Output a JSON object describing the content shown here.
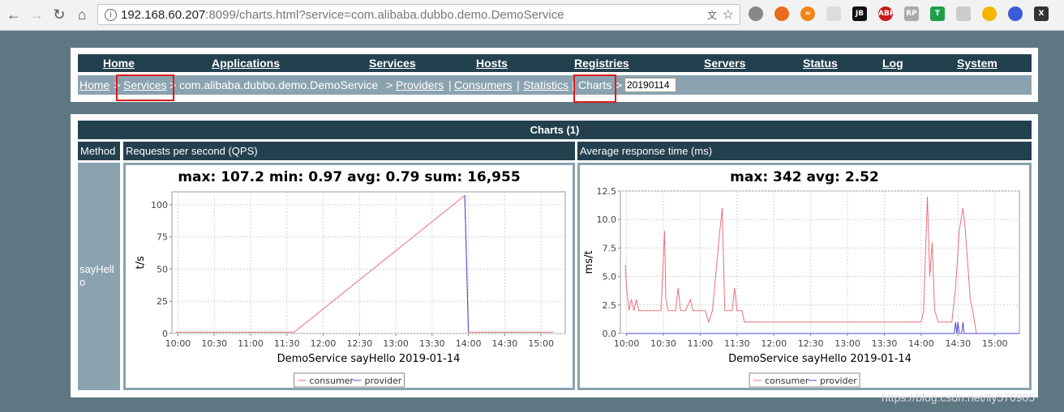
{
  "browser": {
    "url_host": "192.168.60.207",
    "url_rest": ":8099/charts.html?service=com.alibaba.dubbo.demo.DemoService"
  },
  "menu": [
    "Home",
    "Applications",
    "Services",
    "Hosts",
    "Registries",
    "Servers",
    "Status",
    "Log",
    "System"
  ],
  "breadcrumb": {
    "home": "Home",
    "sep1": ">",
    "services": "Services",
    "sep2": ">",
    "service_name": "com.alibaba.dubbo.demo.DemoService",
    "sep3": ">",
    "providers": "Providers",
    "bar1": "|",
    "consumers": "Consumers",
    "bar2": "|",
    "statistics": "Statistics",
    "bar3": "|",
    "charts": "Charts",
    "sep4": ">",
    "date": "20190114"
  },
  "charts_table": {
    "header": "Charts (1)",
    "col_method": "Method",
    "col_qps": "Requests per second (QPS)",
    "col_rt": "Average response time (ms)",
    "method": "sayHello"
  },
  "watermark": "https://blog.csdn.net/lly576905",
  "chart_data": [
    {
      "type": "line",
      "title": "max: 107.2 min: 0.97 avg: 0.79 sum: 16,955",
      "xlabel": "DemoService  sayHello  2019-01-14",
      "ylabel": "t/s",
      "ylim": [
        0,
        110
      ],
      "yticks": [
        "0",
        "25",
        "50",
        "75",
        "100"
      ],
      "xticks": [
        "10:00",
        "10:30",
        "11:00",
        "11:30",
        "12:00",
        "12:30",
        "13:00",
        "13:30",
        "14:00",
        "14:30",
        "15:00"
      ],
      "legend": [
        "consumer",
        "provider"
      ],
      "series": [
        {
          "name": "consumer",
          "color": "#e8707a",
          "points": [
            [
              "09:58",
              1
            ],
            [
              "10:30",
              1
            ],
            [
              "11:00",
              1
            ],
            [
              "11:30",
              1
            ],
            [
              "11:36",
              1
            ],
            [
              "13:57",
              107.2
            ],
            [
              "14:00",
              1
            ],
            [
              "14:30",
              1
            ],
            [
              "15:00",
              1
            ],
            [
              "15:10",
              1
            ]
          ]
        },
        {
          "name": "provider",
          "color": "#4a4ad6",
          "points": [
            [
              "13:57",
              107.2
            ],
            [
              "14:00",
              1
            ]
          ]
        }
      ]
    },
    {
      "type": "line",
      "title": "max: 342 avg: 2.52",
      "xlabel": "DemoService  sayHello  2019-01-14",
      "ylabel": "ms/t",
      "ylim": [
        0,
        12.5
      ],
      "yticks": [
        "0.0",
        "2.5",
        "5.0",
        "7.5",
        "10.0",
        "12.5"
      ],
      "xticks": [
        "10:00",
        "10:30",
        "11:00",
        "11:30",
        "12:00",
        "12:30",
        "13:00",
        "13:30",
        "14:00",
        "14:30",
        "15:00"
      ],
      "legend": [
        "consumer",
        "provider"
      ],
      "series": [
        {
          "name": "consumer",
          "color": "#e8707a",
          "points": [
            [
              "09:59",
              6
            ],
            [
              "10:00",
              4
            ],
            [
              "10:02",
              2
            ],
            [
              "10:04",
              3
            ],
            [
              "10:06",
              2
            ],
            [
              "10:08",
              3
            ],
            [
              "10:10",
              2
            ],
            [
              "10:20",
              2
            ],
            [
              "10:28",
              2
            ],
            [
              "10:31",
              9
            ],
            [
              "10:32",
              3
            ],
            [
              "10:34",
              2
            ],
            [
              "10:40",
              2
            ],
            [
              "10:42",
              4
            ],
            [
              "10:44",
              2
            ],
            [
              "10:48",
              2
            ],
            [
              "10:52",
              3
            ],
            [
              "10:54",
              2
            ],
            [
              "11:00",
              2
            ],
            [
              "11:04",
              2
            ],
            [
              "11:07",
              1
            ],
            [
              "11:10",
              2
            ],
            [
              "11:16",
              9
            ],
            [
              "11:18",
              11
            ],
            [
              "11:20",
              2
            ],
            [
              "11:26",
              2
            ],
            [
              "11:28",
              4
            ],
            [
              "11:30",
              2
            ],
            [
              "11:34",
              2
            ],
            [
              "11:36",
              1
            ],
            [
              "11:40",
              1
            ],
            [
              "12:00",
              1
            ],
            [
              "12:30",
              1
            ],
            [
              "13:00",
              1
            ],
            [
              "13:30",
              1
            ],
            [
              "14:00",
              1
            ],
            [
              "14:02",
              2
            ],
            [
              "14:05",
              12
            ],
            [
              "14:07",
              5
            ],
            [
              "14:09",
              8
            ],
            [
              "14:11",
              2
            ],
            [
              "14:14",
              1
            ],
            [
              "14:20",
              1
            ],
            [
              "14:25",
              1
            ],
            [
              "14:28",
              4
            ],
            [
              "14:31",
              9
            ],
            [
              "14:34",
              11
            ],
            [
              "14:36",
              9
            ],
            [
              "14:38",
              6
            ],
            [
              "14:40",
              3
            ],
            [
              "14:42",
              2
            ],
            [
              "14:45",
              0
            ],
            [
              "14:48",
              0
            ]
          ]
        },
        {
          "name": "provider",
          "color": "#4a4ad6",
          "points": [
            [
              "09:59",
              0
            ],
            [
              "14:27",
              0
            ],
            [
              "14:28",
              1
            ],
            [
              "14:29",
              0
            ],
            [
              "14:30",
              1
            ],
            [
              "14:31",
              0
            ],
            [
              "14:33",
              0
            ],
            [
              "14:34",
              1
            ],
            [
              "14:35",
              0
            ],
            [
              "15:20",
              0
            ]
          ]
        }
      ]
    }
  ]
}
